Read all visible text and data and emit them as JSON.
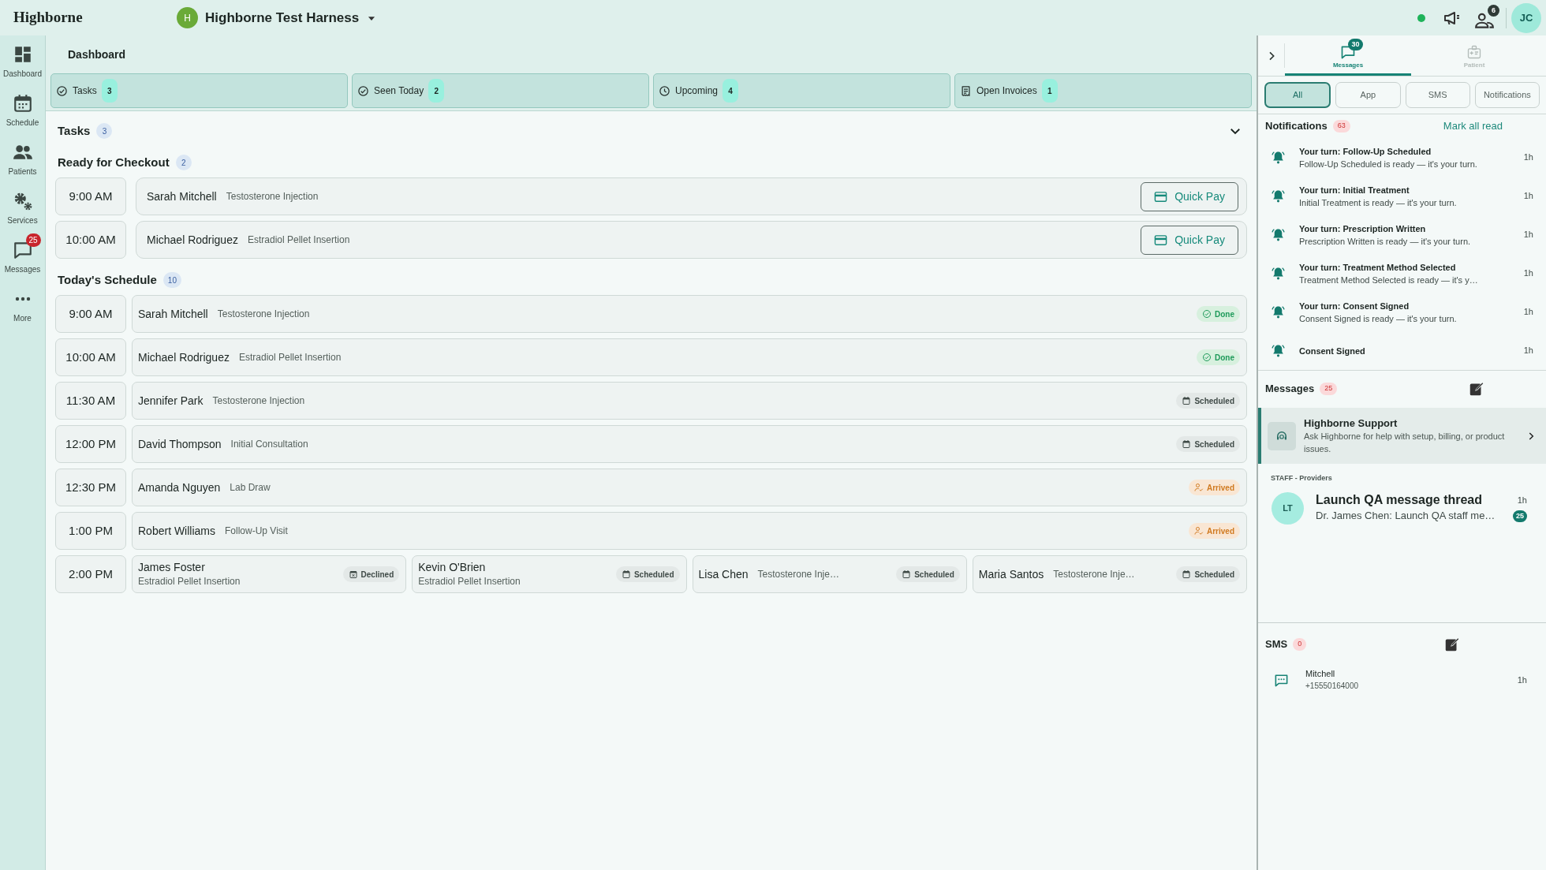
{
  "top_bar": {
    "logo": "Highborne",
    "org": {
      "initial": "H",
      "name": "Highborne Test Harness"
    },
    "alerts_badge": "6",
    "user_initials": "JC"
  },
  "sidebar": {
    "items": [
      {
        "kind": "dashboard",
        "label": "Dashboard"
      },
      {
        "kind": "schedule",
        "label": "Schedule"
      },
      {
        "kind": "patients",
        "label": "Patients"
      },
      {
        "kind": "services",
        "label": "Services"
      },
      {
        "kind": "messages",
        "label": "Messages",
        "badge": "25"
      },
      {
        "kind": "more",
        "label": "More"
      }
    ]
  },
  "page_title": "Dashboard",
  "summary_tabs": [
    {
      "kind": "tasks",
      "label": "Tasks",
      "count": "3"
    },
    {
      "kind": "seen",
      "label": "Seen Today",
      "count": "2"
    },
    {
      "kind": "upcoming",
      "label": "Upcoming",
      "count": "4"
    },
    {
      "kind": "invoices",
      "label": "Open Invoices",
      "count": "1"
    }
  ],
  "tasks": {
    "title": "Tasks",
    "count": "3",
    "expanded": true
  },
  "checkout": {
    "title": "Ready for Checkout",
    "count": "2",
    "rows": [
      {
        "time": "9:00 AM",
        "name": "Sarah Mitchell",
        "service": "Testosterone Injection",
        "action": "Quick Pay"
      },
      {
        "time": "10:00 AM",
        "name": "Michael Rodriguez",
        "service": "Estradiol Pellet Insertion",
        "action": "Quick Pay"
      }
    ]
  },
  "schedule": {
    "title": "Today's Schedule",
    "count": "10",
    "rows": [
      {
        "time": "9:00 AM",
        "appointments": [
          {
            "kind": "inline",
            "name": "Sarah Mitchell",
            "service": "Testosterone Injection",
            "status": {
              "label": "Done",
              "kind": "done"
            }
          }
        ]
      },
      {
        "time": "10:00 AM",
        "appointments": [
          {
            "kind": "inline",
            "name": "Michael Rodriguez",
            "service": "Estradiol Pellet Insertion",
            "status": {
              "label": "Done",
              "kind": "done"
            }
          }
        ]
      },
      {
        "time": "11:30 AM",
        "appointments": [
          {
            "kind": "inline",
            "name": "Jennifer Park",
            "service": "Testosterone Injection",
            "status": {
              "label": "Scheduled",
              "kind": "scheduled"
            }
          }
        ]
      },
      {
        "time": "12:00 PM",
        "appointments": [
          {
            "kind": "inline",
            "name": "David Thompson",
            "service": "Initial Consultation",
            "status": {
              "label": "Scheduled",
              "kind": "scheduled"
            }
          }
        ]
      },
      {
        "time": "12:30 PM",
        "appointments": [
          {
            "kind": "inline",
            "name": "Amanda Nguyen",
            "service": "Lab Draw",
            "status": {
              "label": "Arrived",
              "kind": "arrived"
            }
          }
        ]
      },
      {
        "time": "1:00 PM",
        "appointments": [
          {
            "kind": "inline",
            "name": "Robert Williams",
            "service": "Follow-Up Visit",
            "status": {
              "label": "Arrived",
              "kind": "arrived"
            }
          }
        ]
      },
      {
        "time": "2:00 PM",
        "appointments": [
          {
            "kind": "stacked",
            "name": "James Foster",
            "service": "Estradiol Pellet Insertion",
            "status": {
              "label": "Declined",
              "kind": "declined"
            }
          },
          {
            "kind": "stacked",
            "name": "Kevin O'Brien",
            "service": "Estradiol Pellet Insertion",
            "status": {
              "label": "Scheduled",
              "kind": "scheduled"
            }
          },
          {
            "kind": "inline",
            "name": "Lisa Chen",
            "service": "Testosterone Inje…",
            "status": {
              "label": "Scheduled",
              "kind": "scheduled"
            }
          },
          {
            "kind": "inline",
            "name": "Maria Santos",
            "service": "Testosterone Inje…",
            "status": {
              "label": "Scheduled",
              "kind": "scheduled"
            }
          }
        ]
      }
    ]
  },
  "right_panel": {
    "tabs": [
      {
        "kind": "messages",
        "label": "Messages",
        "badge": "30",
        "selected": true
      },
      {
        "kind": "patient",
        "label": "Patient",
        "selected": false
      }
    ],
    "filters": [
      {
        "label": "All",
        "selected": true
      },
      {
        "label": "App",
        "selected": false
      },
      {
        "label": "SMS",
        "selected": false
      },
      {
        "label": "Notifications",
        "selected": false
      }
    ],
    "notifications": {
      "title": "Notifications",
      "count": "63",
      "action": "Mark all read",
      "items": [
        {
          "title": "Your turn: Follow-Up Scheduled",
          "body": "Follow-Up Scheduled is ready — it's your turn.",
          "time": "1h"
        },
        {
          "title": "Your turn: Initial Treatment",
          "body": "Initial Treatment is ready — it's your turn.",
          "time": "1h"
        },
        {
          "title": "Your turn: Prescription Written",
          "body": "Prescription Written is ready — it's your turn.",
          "time": "1h"
        },
        {
          "title": "Your turn: Treatment Method Selected",
          "body": "Treatment Method Selected is ready — it's y…",
          "time": "1h"
        },
        {
          "title": "Your turn: Consent Signed",
          "body": "Consent Signed is ready — it's your turn.",
          "time": "1h"
        },
        {
          "title": "Consent Signed",
          "time": "1h"
        }
      ]
    },
    "messages": {
      "title": "Messages",
      "count": "25",
      "support": {
        "title": "Highborne Support",
        "body": "Ask Highborne for help with setup, billing, or product issues."
      },
      "group": "STAFF - Providers",
      "threads": [
        {
          "initials": "LT",
          "title": "Launch QA message thread",
          "preview": "Dr. James Chen: Launch QA staff me…",
          "time": "1h",
          "unread": "25"
        }
      ]
    },
    "sms": {
      "title": "SMS",
      "count": "0",
      "items": [
        {
          "name": "Mitchell",
          "phone": "+15550164000",
          "time": "1h"
        }
      ]
    }
  }
}
